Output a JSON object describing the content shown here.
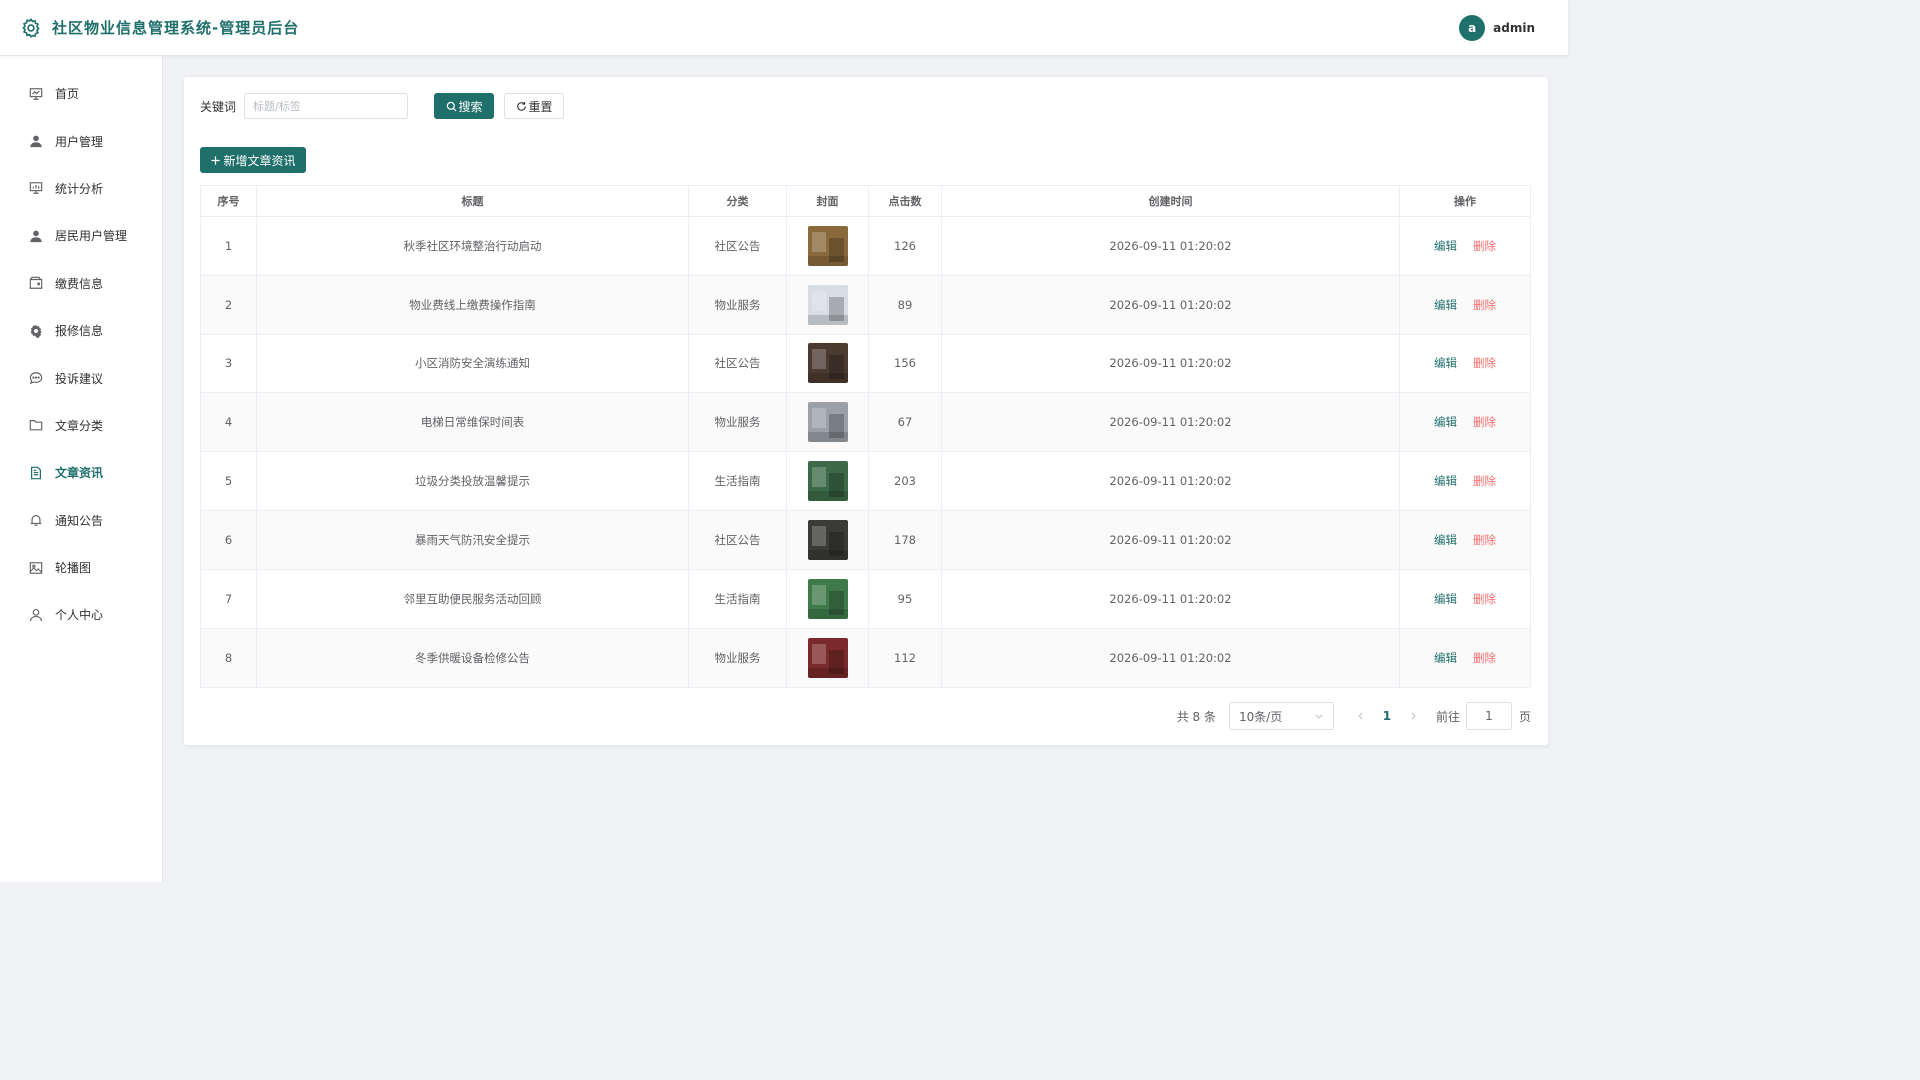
{
  "header": {
    "title": "社区物业信息管理系统-管理员后台",
    "avatar_letter": "a",
    "username": "admin"
  },
  "sidebar": {
    "items": [
      {
        "label": "首页",
        "icon": "presentation-icon"
      },
      {
        "label": "用户管理",
        "icon": "user-icon"
      },
      {
        "label": "统计分析",
        "icon": "chart-board-icon"
      },
      {
        "label": "居民用户管理",
        "icon": "user-icon"
      },
      {
        "label": "缴费信息",
        "icon": "wallet-icon"
      },
      {
        "label": "报修信息",
        "icon": "gear-icon"
      },
      {
        "label": "投诉建议",
        "icon": "chat-icon"
      },
      {
        "label": "文章分类",
        "icon": "folder-icon"
      },
      {
        "label": "文章资讯",
        "icon": "document-icon"
      },
      {
        "label": "通知公告",
        "icon": "bell-icon"
      },
      {
        "label": "轮播图",
        "icon": "picture-icon"
      },
      {
        "label": "个人中心",
        "icon": "person-outline-icon"
      }
    ],
    "active_index": 8
  },
  "search": {
    "label": "关键词",
    "placeholder": "标题/标签",
    "search_label": "搜索",
    "reset_label": "重置"
  },
  "toolbar": {
    "add_label": "新增文章资讯"
  },
  "table": {
    "headers": [
      "序号",
      "标题",
      "分类",
      "封面",
      "点击数",
      "创建时间",
      "操作"
    ],
    "edit_label": "编辑",
    "delete_label": "删除",
    "rows": [
      {
        "index": "1",
        "title": "秋季社区环境整治行动启动",
        "category": "社区公告",
        "clicks": "126",
        "created": "2026-09-11 01:20:02",
        "cover_color": "#8a6a3c"
      },
      {
        "index": "2",
        "title": "物业费线上缴费操作指南",
        "category": "物业服务",
        "clicks": "89",
        "created": "2026-09-11 01:20:02",
        "cover_color": "#d8dde2"
      },
      {
        "index": "3",
        "title": "小区消防安全演练通知",
        "category": "社区公告",
        "clicks": "156",
        "created": "2026-09-11 01:20:02",
        "cover_color": "#4a3a30"
      },
      {
        "index": "4",
        "title": "电梯日常维保时间表",
        "category": "物业服务",
        "clicks": "67",
        "created": "2026-09-11 01:20:02",
        "cover_color": "#9aa0a6"
      },
      {
        "index": "5",
        "title": "垃圾分类投放温馨提示",
        "category": "生活指南",
        "clicks": "203",
        "created": "2026-09-11 01:20:02",
        "cover_color": "#3c6a48"
      },
      {
        "index": "6",
        "title": "暴雨天气防汛安全提示",
        "category": "社区公告",
        "clicks": "178",
        "created": "2026-09-11 01:20:02",
        "cover_color": "#3a3a36"
      },
      {
        "index": "7",
        "title": "邻里互助便民服务活动回顾",
        "category": "生活指南",
        "clicks": "95",
        "created": "2026-09-11 01:20:02",
        "cover_color": "#3f7a4a"
      },
      {
        "index": "8",
        "title": "冬季供暖设备检修公告",
        "category": "物业服务",
        "clicks": "112",
        "created": "2026-09-11 01:20:02",
        "cover_color": "#7a2a2a"
      }
    ]
  },
  "pagination": {
    "total_text": "共 8 条",
    "page_size": "10条/页",
    "current_page": "1",
    "goto_label": "前往",
    "goto_value": "1",
    "page_unit": "页"
  },
  "colors": {
    "primary": "#1f6f6b",
    "danger": "#f56c6c"
  }
}
